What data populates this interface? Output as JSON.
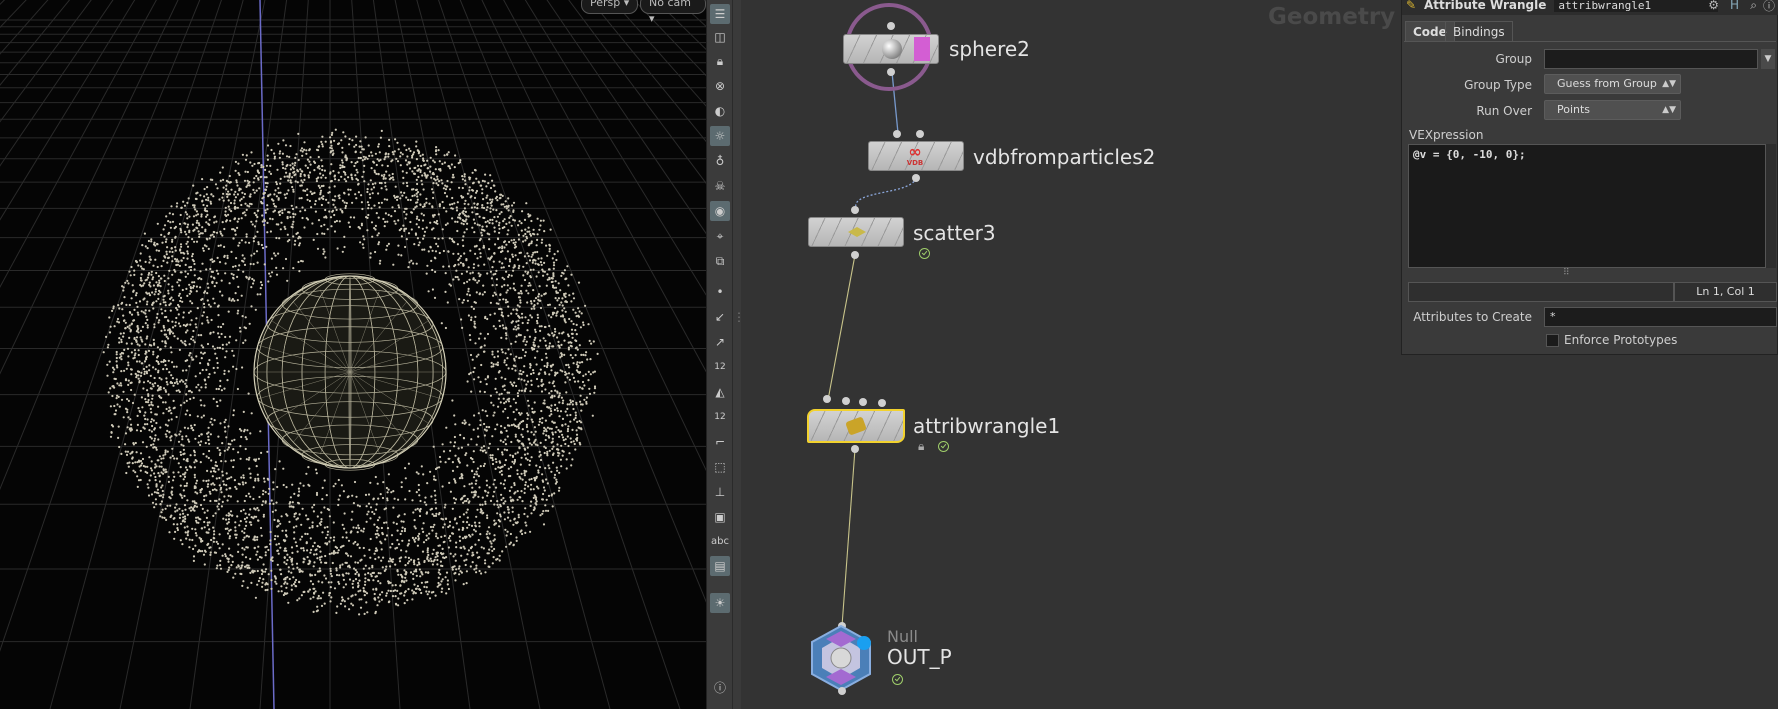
{
  "viewport": {
    "persp_label": "Persp",
    "cam_label": "No cam"
  },
  "toolbar": {
    "text_tool_label": "abc",
    "count_label_1": "12",
    "count_label_2": "12"
  },
  "network": {
    "context_label": "Geometry",
    "nodes": {
      "sphere": {
        "name": "sphere2"
      },
      "vdb": {
        "name": "vdbfromparticles2",
        "icon_text": "VDB"
      },
      "scatter": {
        "name": "scatter3"
      },
      "wrangle": {
        "name": "attribwrangle1"
      },
      "null": {
        "type": "Null",
        "name": "OUT_P"
      }
    }
  },
  "params": {
    "node_type": "Attribute Wrangle",
    "node_name": "attribwrangle1",
    "tabs": [
      "Code",
      "Bindings"
    ],
    "group_label": "Group",
    "group_value": "",
    "group_type_label": "Group Type",
    "group_type_value": "Guess from Group",
    "run_over_label": "Run Over",
    "run_over_value": "Points",
    "vex_label": "VEXpression",
    "vex_code": "@v = {0, -10, 0};",
    "cursor_pos": "Ln 1, Col 1",
    "attributes_label": "Attributes to Create",
    "attributes_value": "*",
    "enforce_label": "Enforce Prototypes"
  },
  "colors": {
    "wrangle_outline": "#f2d22e",
    "sphere_ring": "#8a5a8e",
    "wire": "#c8c48a",
    "flag_green": "#9fce6a"
  }
}
